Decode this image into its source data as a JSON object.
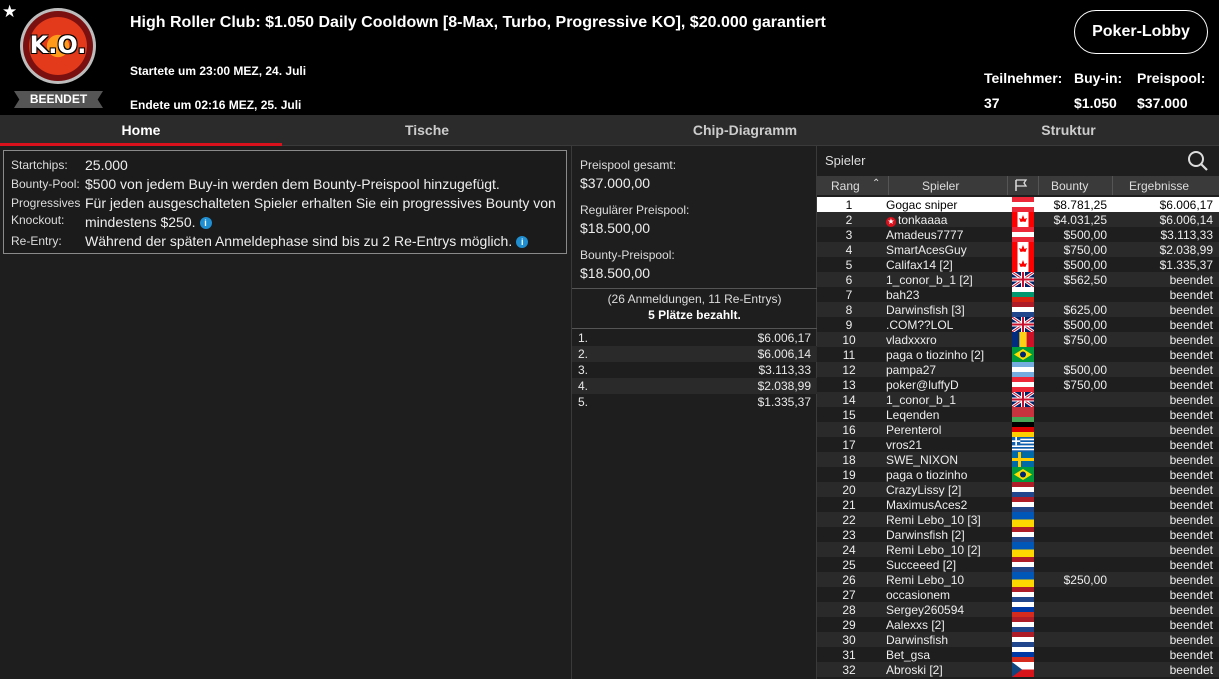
{
  "header": {
    "title": "High Roller Club: $1.050 Daily Cooldown [8-Max, Turbo, Progressive KO], $20.000 garantiert",
    "logo_text": "K.O.",
    "status_badge": "BEENDET",
    "started": "Startete um 23:00 MEZ, 24. Juli",
    "ended": "Endete um 02:16 MEZ, 25. Juli",
    "lobby_button": "Poker-Lobby",
    "stats": [
      {
        "label": "Teilnehmer:",
        "value": "37"
      },
      {
        "label": "Buy-in:",
        "value": "$1.050"
      },
      {
        "label": "Preispool:",
        "value": "$37.000"
      }
    ]
  },
  "tabs": [
    {
      "label": "Home",
      "active": true
    },
    {
      "label": "Tische",
      "active": false
    },
    {
      "label": "Chip-Diagramm",
      "active": false
    },
    {
      "label": "Struktur",
      "active": false
    }
  ],
  "info": {
    "startchips_label": "Startchips:",
    "startchips_value": "25.000",
    "bounty_label": "Bounty-Pool:",
    "bounty_value": "$500 von jedem Buy-in werden dem Bounty-Preispool hinzugefügt.",
    "pko_label_1": "Progressives",
    "pko_label_2": "Knockout:",
    "pko_value_1": "Für jeden ausgeschalteten Spieler erhalten Sie ein progressives Bounty von",
    "pko_value_2": "mindestens $250.",
    "reentry_label": "Re-Entry:",
    "reentry_value": "Während der späten Anmeldephase sind bis zu 2 Re-Entrys möglich.",
    "info_icon": "i"
  },
  "pools": [
    {
      "label": "Preispool gesamt:",
      "value": "$37.000,00"
    },
    {
      "label": "Regulärer Preispool:",
      "value": "$18.500,00"
    },
    {
      "label": "Bounty-Preispool:",
      "value": "$18.500,00"
    }
  ],
  "entries_text": "(26 Anmeldungen, 11 Re-Entrys)",
  "paid_text": "5 Plätze bezahlt.",
  "payouts": [
    {
      "place": "1.",
      "amount": "$6.006,17"
    },
    {
      "place": "2.",
      "amount": "$6.006,14"
    },
    {
      "place": "3.",
      "amount": "$3.113,33"
    },
    {
      "place": "4.",
      "amount": "$2.038,99"
    },
    {
      "place": "5.",
      "amount": "$1.335,37"
    }
  ],
  "players_list": {
    "search_label": "Spieler",
    "columns": {
      "rank": "Rang",
      "player": "Spieler",
      "bounty": "Bounty",
      "result": "Ergebnisse"
    },
    "rows": [
      {
        "rank": "1",
        "player": "Gogac sniper",
        "flag": "at",
        "bounty": "$8.781,25",
        "result": "$6.006,17"
      },
      {
        "rank": "2",
        "player": "tonkaaaa",
        "flag": "ca",
        "bounty": "$4.031,25",
        "result": "$6.006,14",
        "star": true
      },
      {
        "rank": "3",
        "player": "Amadeus7777",
        "flag": "at",
        "bounty": "$500,00",
        "result": "$3.113,33"
      },
      {
        "rank": "4",
        "player": "SmartAcesGuy",
        "flag": "ca",
        "bounty": "$750,00",
        "result": "$2.038,99"
      },
      {
        "rank": "5",
        "player": "Califax14 [2]",
        "flag": "ca",
        "bounty": "$500,00",
        "result": "$1.335,37"
      },
      {
        "rank": "6",
        "player": "1_conor_b_1 [2]",
        "flag": "gb",
        "bounty": "$562,50",
        "result": "beendet"
      },
      {
        "rank": "7",
        "player": "bah23",
        "flag": "bg",
        "bounty": "",
        "result": "beendet"
      },
      {
        "rank": "8",
        "player": "Darwinsfish [3]",
        "flag": "nl",
        "bounty": "$625,00",
        "result": "beendet"
      },
      {
        "rank": "9",
        "player": ".COM??LOL",
        "flag": "gb",
        "bounty": "$500,00",
        "result": "beendet"
      },
      {
        "rank": "10",
        "player": "vladxxxro",
        "flag": "ro",
        "bounty": "$750,00",
        "result": "beendet"
      },
      {
        "rank": "11",
        "player": "paga o tiozinho [2]",
        "flag": "br",
        "bounty": "",
        "result": "beendet"
      },
      {
        "rank": "12",
        "player": "pampa27",
        "flag": "ar",
        "bounty": "$500,00",
        "result": "beendet"
      },
      {
        "rank": "13",
        "player": "poker@luffyD",
        "flag": "at",
        "bounty": "$750,00",
        "result": "beendet"
      },
      {
        "rank": "14",
        "player": "1_conor_b_1",
        "flag": "gb",
        "bounty": "",
        "result": "beendet"
      },
      {
        "rank": "15",
        "player": "Leqenden",
        "flag": "by",
        "bounty": "",
        "result": "beendet"
      },
      {
        "rank": "16",
        "player": "Perenterol",
        "flag": "de",
        "bounty": "",
        "result": "beendet"
      },
      {
        "rank": "17",
        "player": "vros21",
        "flag": "gr",
        "bounty": "",
        "result": "beendet"
      },
      {
        "rank": "18",
        "player": "SWE_NIXON",
        "flag": "se",
        "bounty": "",
        "result": "beendet"
      },
      {
        "rank": "19",
        "player": "paga o tiozinho",
        "flag": "br",
        "bounty": "",
        "result": "beendet"
      },
      {
        "rank": "20",
        "player": "CrazyLissy [2]",
        "flag": "nl",
        "bounty": "",
        "result": "beendet"
      },
      {
        "rank": "21",
        "player": "MaximusAces2",
        "flag": "nl",
        "bounty": "",
        "result": "beendet"
      },
      {
        "rank": "22",
        "player": "Remi Lebo_10 [3]",
        "flag": "ua",
        "bounty": "",
        "result": "beendet"
      },
      {
        "rank": "23",
        "player": "Darwinsfish [2]",
        "flag": "nl",
        "bounty": "",
        "result": "beendet"
      },
      {
        "rank": "24",
        "player": "Remi Lebo_10 [2]",
        "flag": "ua",
        "bounty": "",
        "result": "beendet"
      },
      {
        "rank": "25",
        "player": "Succeeed [2]",
        "flag": "nl",
        "bounty": "",
        "result": "beendet"
      },
      {
        "rank": "26",
        "player": "Remi Lebo_10",
        "flag": "ua",
        "bounty": "$250,00",
        "result": "beendet"
      },
      {
        "rank": "27",
        "player": "occasionem",
        "flag": "nl",
        "bounty": "",
        "result": "beendet"
      },
      {
        "rank": "28",
        "player": "Sergey260594",
        "flag": "ru",
        "bounty": "",
        "result": "beendet"
      },
      {
        "rank": "29",
        "player": "Aalexxs [2]",
        "flag": "nl",
        "bounty": "",
        "result": "beendet"
      },
      {
        "rank": "30",
        "player": "Darwinsfish",
        "flag": "nl",
        "bounty": "",
        "result": "beendet"
      },
      {
        "rank": "31",
        "player": "Bet_gsa",
        "flag": "ru",
        "bounty": "",
        "result": "beendet"
      },
      {
        "rank": "32",
        "player": "Abroski [2]",
        "flag": "cz",
        "bounty": "",
        "result": "beendet"
      }
    ]
  },
  "colors": {
    "accent": "#d8111c",
    "background": "#1e1e1e",
    "header": "#000000",
    "info_icon": "#1f8fd1"
  }
}
